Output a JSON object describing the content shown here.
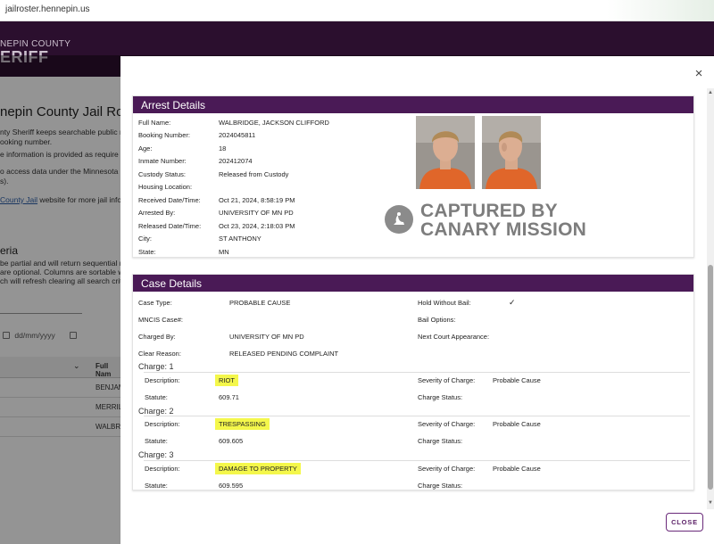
{
  "browser": {
    "url": "jailroster.hennepin.us"
  },
  "background": {
    "logo_line1": "NEPIN COUNTY",
    "logo_line2": "ERIFF",
    "page_title": "nepin County Jail Ro",
    "intro_lines": [
      "nty Sheriff keeps searchable public r",
      "ooking number."
    ],
    "info_line": "e information is provided as require",
    "access_lines": [
      "o access data under the Minnesota",
      "s)."
    ],
    "link_text": "County Jail",
    "link_suffix": " website for more jail info",
    "criteria_title": "eria",
    "criteria_lines": [
      "be partial and will return sequential ma",
      "are optional. Columns are sortable whe",
      "ch will refresh clearing all search criter"
    ],
    "date_placeholder": "dd/mm/yyyy",
    "table_col_header": "Full Nam",
    "sort_icon": "⌄",
    "rows": [
      "BENJAM",
      "MERRIL",
      "WALBR"
    ]
  },
  "arrest": {
    "header": "Arrest Details",
    "fields": [
      {
        "label": "Full Name:",
        "value": "WALBRIDGE, JACKSON CLIFFORD"
      },
      {
        "label": "Booking Number:",
        "value": "2024045811"
      },
      {
        "label": "Age:",
        "value": "18"
      },
      {
        "label": "Inmate Number:",
        "value": "202412074"
      },
      {
        "label": "Custody Status:",
        "value": "Released from Custody"
      },
      {
        "label": "Housing Location:",
        "value": ""
      },
      {
        "label": "Received Date/Time:",
        "value": "Oct 21, 2024, 8:58:19 PM"
      },
      {
        "label": "Arrested By:",
        "value": "UNIVERSITY OF MN PD"
      },
      {
        "label": "Released Date/Time:",
        "value": "Oct 23, 2024, 2:18:03 PM"
      },
      {
        "label": "City:",
        "value": "ST ANTHONY"
      },
      {
        "label": "State:",
        "value": "MN"
      }
    ],
    "watermark_line1": "CAPTURED BY",
    "watermark_line2": "CANARY MISSION"
  },
  "case": {
    "header": "Case Details",
    "left": [
      {
        "label": "Case Type:",
        "value": "PROBABLE CAUSE"
      },
      {
        "label": "MNCIS Case#:",
        "value": ""
      },
      {
        "label": "Charged By:",
        "value": "UNIVERSITY OF MN PD"
      },
      {
        "label": "Clear Reason:",
        "value": "RELEASED PENDING COMPLAINT"
      }
    ],
    "right": [
      {
        "label": "Hold Without Bail:",
        "value": "✓"
      },
      {
        "label": "Bail Options:",
        "value": ""
      },
      {
        "label": "Next Court Appearance:",
        "value": ""
      }
    ],
    "charges": [
      {
        "title": "Charge: 1",
        "desc_label": "Description:",
        "description": "RIOT",
        "statute_label": "Statute:",
        "statute": "609.71",
        "severity_label": "Severity of Charge:",
        "severity": "Probable Cause",
        "status_label": "Charge Status:",
        "status": ""
      },
      {
        "title": "Charge: 2",
        "desc_label": "Description:",
        "description": "TRESPASSING",
        "statute_label": "Statute:",
        "statute": "609.605",
        "severity_label": "Severity of Charge:",
        "severity": "Probable Cause",
        "status_label": "Charge Status:",
        "status": ""
      },
      {
        "title": "Charge: 3",
        "desc_label": "Description:",
        "description": "DAMAGE TO PROPERTY",
        "statute_label": "Statute:",
        "statute": "609.595",
        "severity_label": "Severity of Charge:",
        "severity": "Probable Cause",
        "status_label": "Charge Status:",
        "status": ""
      }
    ]
  },
  "modal": {
    "close_icon": "close-icon",
    "close_x": "×",
    "close_button": "CLOSE"
  },
  "colors": {
    "header_purple": "#4a1a56",
    "dark_header": "#2b0f2e",
    "highlight": "#f4f74b",
    "mug_background": "#e0662a"
  }
}
